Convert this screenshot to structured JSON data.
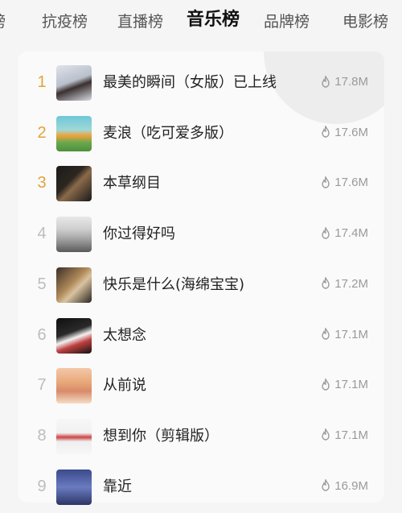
{
  "tabs": [
    "榜",
    "抗疫榜",
    "直播榜",
    "音乐榜",
    "品牌榜",
    "电影榜"
  ],
  "active_tab": "音乐榜",
  "list": [
    {
      "rank": "1",
      "title": "最美的瞬间（女版）已上线",
      "hot": "17.8M"
    },
    {
      "rank": "2",
      "title": "麦浪（吃可爱多版）",
      "hot": "17.6M"
    },
    {
      "rank": "3",
      "title": "本草纲目",
      "hot": "17.6M"
    },
    {
      "rank": "4",
      "title": "你过得好吗",
      "hot": "17.4M"
    },
    {
      "rank": "5",
      "title": "快乐是什么(海绵宝宝)",
      "hot": "17.2M"
    },
    {
      "rank": "6",
      "title": "太想念",
      "hot": "17.1M"
    },
    {
      "rank": "7",
      "title": "从前说",
      "hot": "17.1M"
    },
    {
      "rank": "8",
      "title": "想到你（剪辑版）",
      "hot": "17.1M"
    },
    {
      "rank": "9",
      "title": "靠近",
      "hot": "16.9M"
    }
  ],
  "colors": {
    "top_rank": "#e2a33b",
    "rank": "#bdbdbd",
    "active_tab": "#111111"
  },
  "icons": {
    "hot": "flame-icon"
  }
}
